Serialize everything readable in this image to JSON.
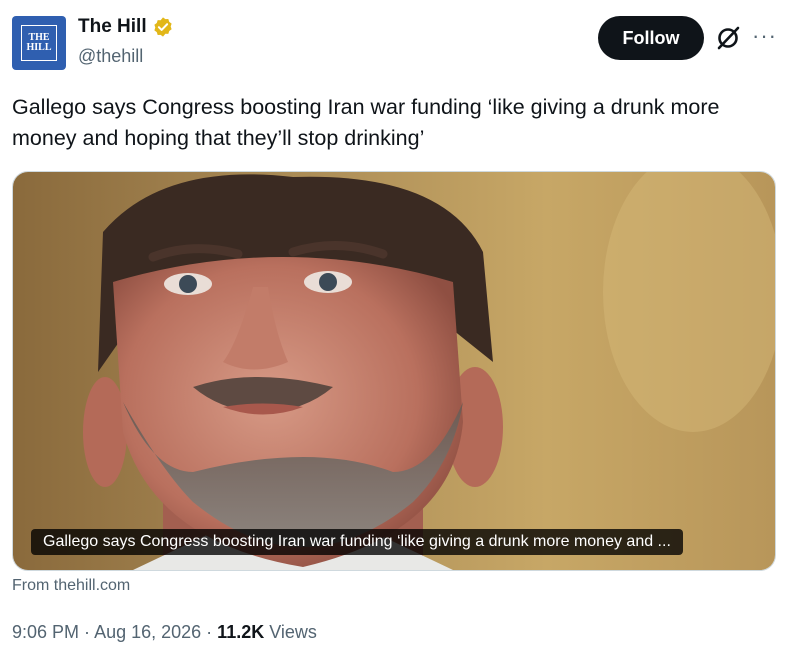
{
  "account": {
    "logo_line1": "THE",
    "logo_line2": "HILL",
    "display_name": "The Hill",
    "handle": "@thehill",
    "verified_color": "#e2b719"
  },
  "actions": {
    "follow_label": "Follow",
    "more_label": "···",
    "grok_icon": "grok-icon"
  },
  "tweet": {
    "text": "Gallego says Congress boosting Iran war funding ‘like giving a drunk more money and hoping that they’ll stop drinking’"
  },
  "card": {
    "caption": "Gallego says Congress boosting Iran war funding ‘like giving a drunk more money and ...",
    "source": "From thehill.com"
  },
  "meta": {
    "time": "9:06 PM",
    "sep1": " · ",
    "date": "Aug 16, 2026",
    "sep2": " · ",
    "views_count": "11.2K",
    "views_label": " Views"
  },
  "colors": {
    "follow_bg": "#0f1419",
    "secondary_text": "#536471",
    "brand_blue": "#2f5fb0"
  }
}
